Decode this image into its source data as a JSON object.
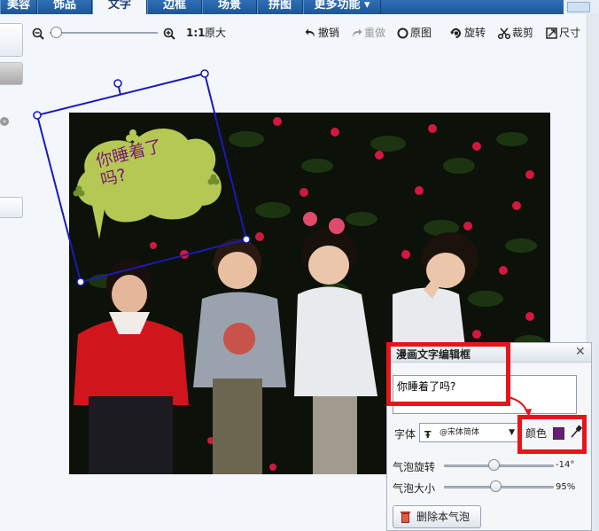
{
  "tabs": [
    {
      "label": "美容",
      "active": false
    },
    {
      "label": "饰品",
      "active": false
    },
    {
      "label": "文字",
      "active": true
    },
    {
      "label": "边框",
      "active": false
    },
    {
      "label": "场景",
      "active": false
    },
    {
      "label": "拼图",
      "active": false
    },
    {
      "label": "更多功能 ▾",
      "active": false
    }
  ],
  "toolbar": {
    "one_to_one": "1:1",
    "original_size": "原大",
    "undo": "撤销",
    "redo": "重做",
    "original": "原图",
    "rotate": "旋转",
    "crop": "裁剪",
    "size": "尺寸",
    "zoom_level": 0.1
  },
  "canvas": {
    "bubble_line1": "你睡着了",
    "bubble_line2": "吗?",
    "bubble_rotation_deg": -14,
    "bubble_color": "#b5c854",
    "selection_color": "#1a1ab8"
  },
  "editor": {
    "title": "漫画文字编辑框",
    "close": "✕",
    "text_value": "你睡着了吗?",
    "font_label": "字体",
    "font_name": "@宋体简体",
    "color_label": "颜色",
    "color_value": "#6b1b7a",
    "rotation_label": "气泡旋转",
    "rotation_value": "-14°",
    "size_label": "气泡大小",
    "size_value": "95%",
    "delete_label": "删除本气泡"
  },
  "highlight_color": "#e8141b"
}
